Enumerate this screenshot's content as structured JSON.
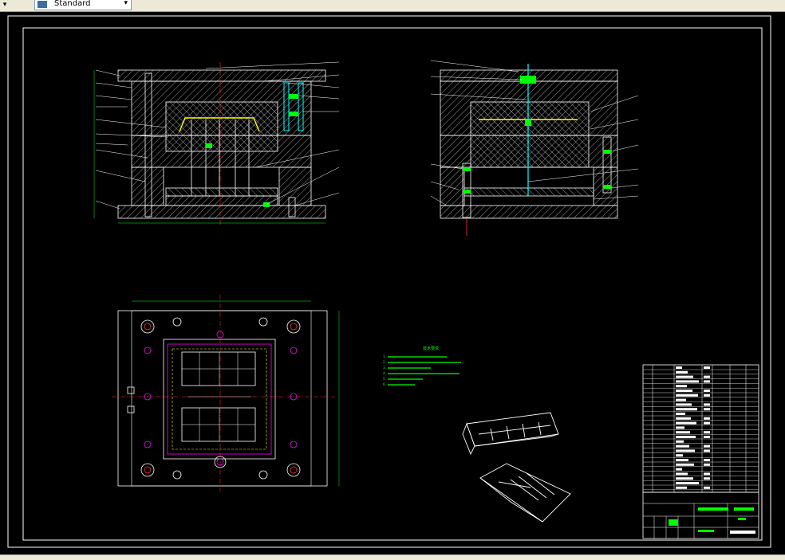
{
  "toolbar": {
    "style_select_value": "Standard"
  },
  "drawing": {
    "tech_requirements_title": "技术要求",
    "tech_requirements": [
      "1.",
      "2.",
      "3.",
      "4.",
      "5.",
      "6."
    ]
  },
  "colors": {
    "background": "#000000",
    "line_white": "#ffffff",
    "line_green": "#00ff00",
    "line_yellow": "#ffff00",
    "line_cyan": "#00ffff",
    "line_magenta": "#ff00ff",
    "line_red": "#ff3030"
  }
}
